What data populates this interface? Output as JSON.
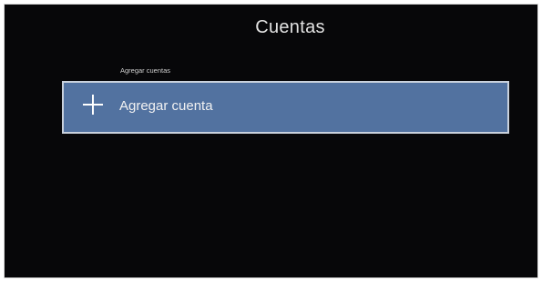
{
  "header": {
    "title": "Cuentas"
  },
  "accounts_section": {
    "label": "Agregar cuentas",
    "add_account": {
      "icon": "plus-icon",
      "label": "Agregar cuenta"
    }
  },
  "colors": {
    "background": "#070709",
    "selected_row": "#5272a0",
    "focus_border": "#c9d1dc",
    "text": "#e2e2e2"
  }
}
